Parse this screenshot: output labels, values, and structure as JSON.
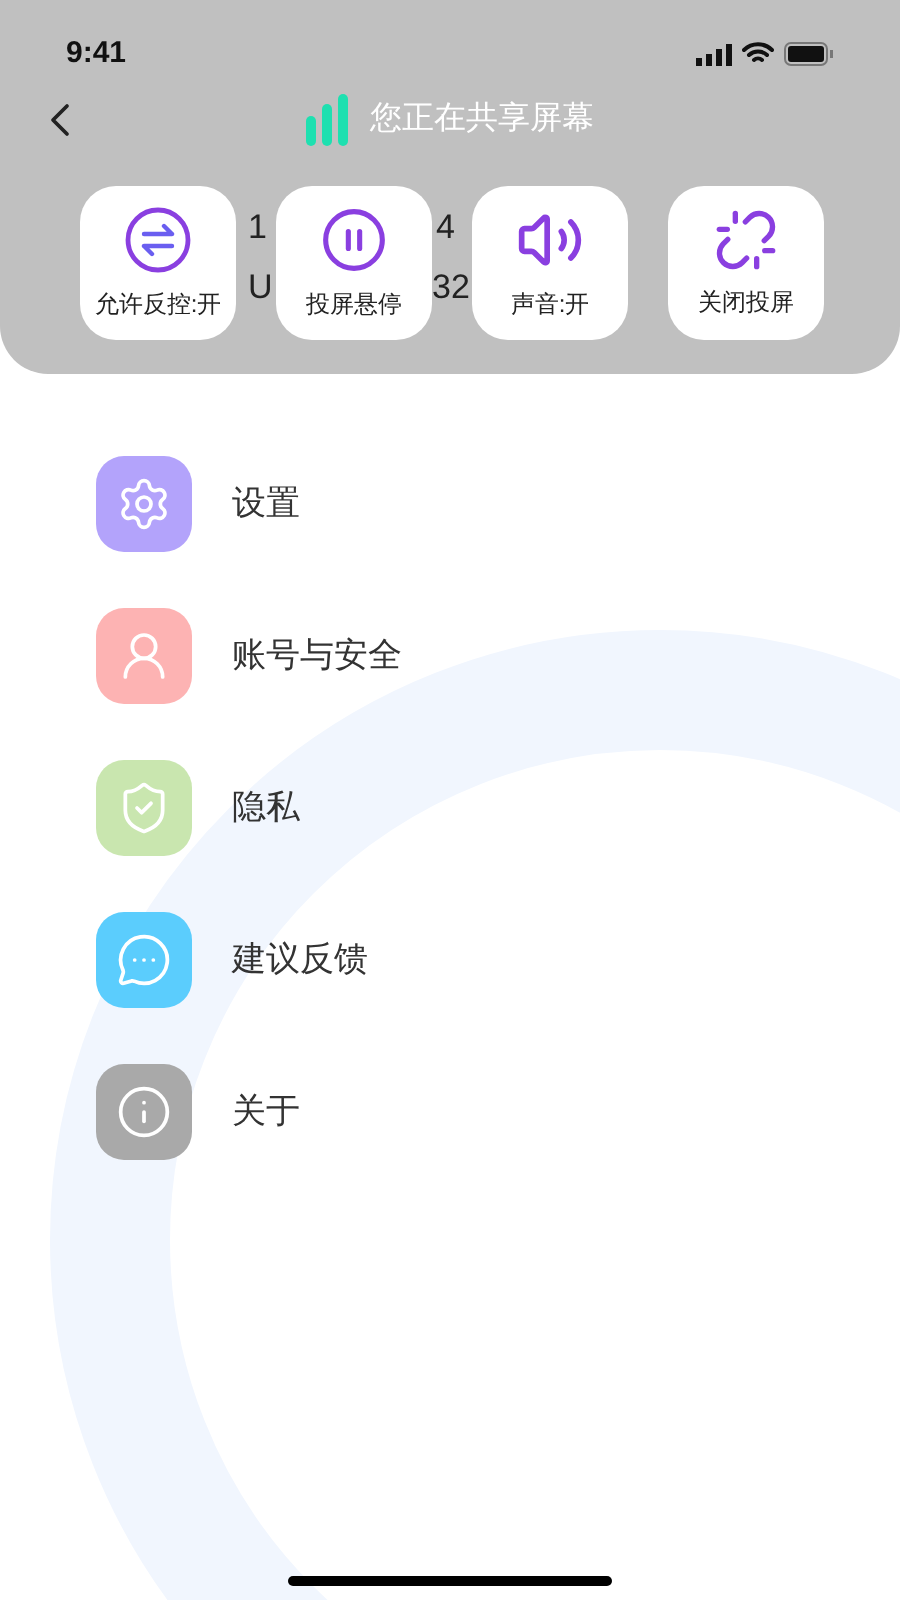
{
  "status_bar": {
    "time": "9:41"
  },
  "header": {
    "title": "您正在共享屏幕"
  },
  "covered_text": [
    "1",
    "4",
    "U",
    "32"
  ],
  "controls": [
    {
      "label": "允许反控:开",
      "kind": "swap"
    },
    {
      "label": "投屏悬停",
      "kind": "pause"
    },
    {
      "label": "声音:开",
      "kind": "sound"
    },
    {
      "label": "关闭投屏",
      "kind": "unlink"
    }
  ],
  "menu": [
    {
      "label": "设置",
      "kind": "settings",
      "color": "#b3a3fb"
    },
    {
      "label": "账号与安全",
      "kind": "account",
      "color": "#fdb3b3"
    },
    {
      "label": "隐私",
      "kind": "privacy",
      "color": "#c9e6af"
    },
    {
      "label": "建议反馈",
      "kind": "feedback",
      "color": "#5bcdfd"
    },
    {
      "label": "关于",
      "kind": "about",
      "color": "#a9a9a9"
    }
  ]
}
